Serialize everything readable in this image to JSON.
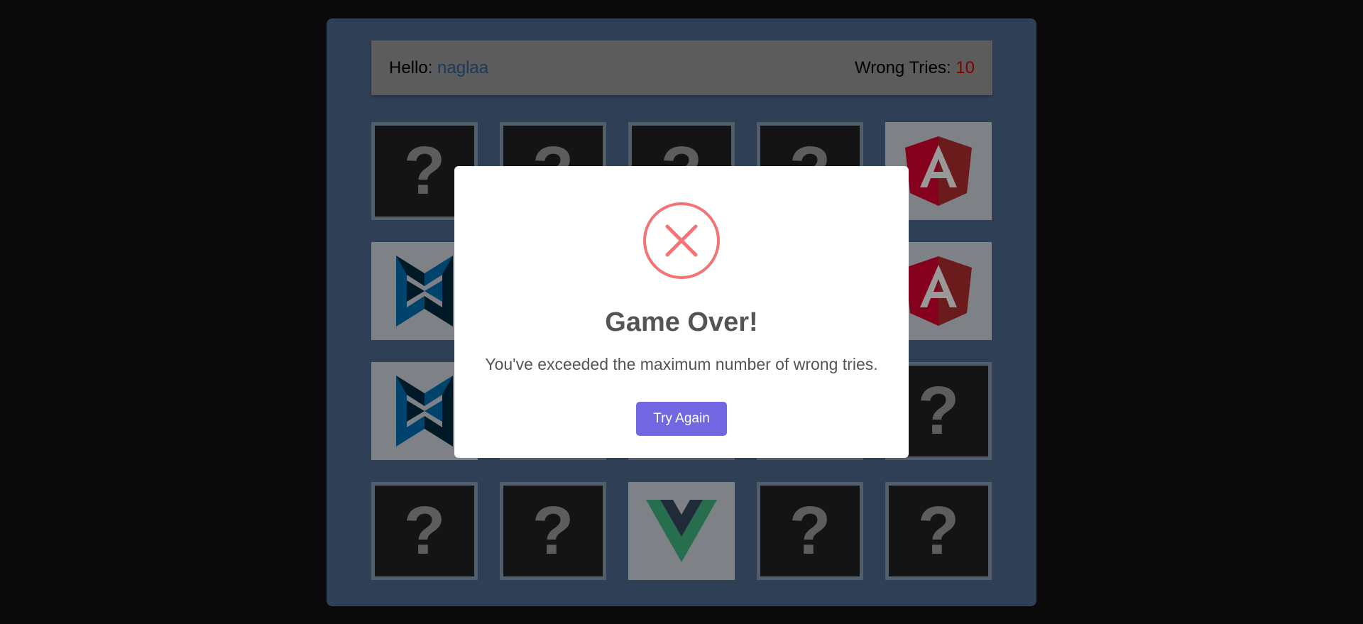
{
  "colors": {
    "page_background": "#111111",
    "panel_background": "#4f6a90",
    "info_bar_background": "#9a9a9a",
    "username_color": "#2f5f96",
    "tries_color": "#d70000",
    "card_back": "#222222",
    "card_front": "#d3d9e2",
    "button_color": "#7366e1",
    "error_icon_color": "#f27474"
  },
  "header": {
    "hello_label": "Hello:",
    "username": "naglaa",
    "wrong_tries_label": "Wrong Tries:",
    "wrong_tries_value": "10"
  },
  "board": {
    "cards": [
      {
        "state": "hidden",
        "symbol": "?"
      },
      {
        "state": "hidden",
        "symbol": "?"
      },
      {
        "state": "hidden",
        "symbol": "?"
      },
      {
        "state": "hidden",
        "symbol": "?"
      },
      {
        "state": "revealed",
        "icon": "angular-icon"
      },
      {
        "state": "revealed",
        "icon": "backbone-icon"
      },
      {
        "state": "hidden",
        "symbol": "?"
      },
      {
        "state": "hidden",
        "symbol": "?"
      },
      {
        "state": "hidden",
        "symbol": "?"
      },
      {
        "state": "revealed",
        "icon": "angular-icon"
      },
      {
        "state": "revealed",
        "icon": "backbone-icon"
      },
      {
        "state": "hidden",
        "symbol": "?"
      },
      {
        "state": "hidden",
        "symbol": "?"
      },
      {
        "state": "hidden",
        "symbol": "?"
      },
      {
        "state": "hidden",
        "symbol": "?"
      },
      {
        "state": "hidden",
        "symbol": "?"
      },
      {
        "state": "hidden",
        "symbol": "?"
      },
      {
        "state": "revealed",
        "icon": "vue-icon"
      },
      {
        "state": "hidden",
        "symbol": "?"
      },
      {
        "state": "hidden",
        "symbol": "?"
      }
    ]
  },
  "modal": {
    "icon": "error-x-icon",
    "title": "Game Over!",
    "message": "You've exceeded the maximum number of wrong tries.",
    "button_label": "Try Again"
  }
}
